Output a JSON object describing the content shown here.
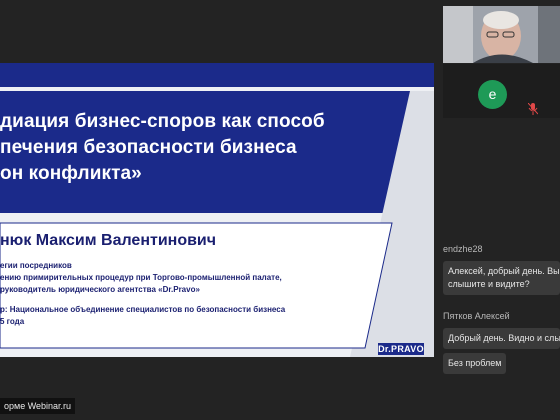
{
  "slide": {
    "title_lines": [
      "диация бизнес-споров как способ",
      "печения безопасности бизнеса",
      "он конфликта»"
    ],
    "presenter_name": "нюк Максим Валентинович",
    "info_lines": [
      "егии посредников",
      "ению примирительных процедур при Торгово-промышленной палате,",
      "руководитель юридического агентства «Dr.Pravo»",
      "р: Национальное объединение специалистов по безопасности бизнеса",
      "5 года"
    ],
    "logo_text": "Dr.PRAVO",
    "colors": {
      "accent": "#1b2a8a",
      "text": "#1a1f70"
    }
  },
  "watermark": "орме Webinar.ru",
  "participants": [
    {
      "type": "video"
    },
    {
      "type": "avatar",
      "initial": "e",
      "avatar_color": "#1e9a57",
      "mic_icon": "mic-muted-icon"
    }
  ],
  "chat": {
    "messages": [
      {
        "author": "endzhe28",
        "text_lines": [
          "Алексей, добрый день. Вы н",
          "слышите и видите?"
        ]
      },
      {
        "author": "Пятков Алексей",
        "text_lines": [
          "Добрый день. Видно и слыш"
        ]
      },
      {
        "author": "",
        "text_lines": [
          "Без проблем"
        ]
      }
    ]
  }
}
